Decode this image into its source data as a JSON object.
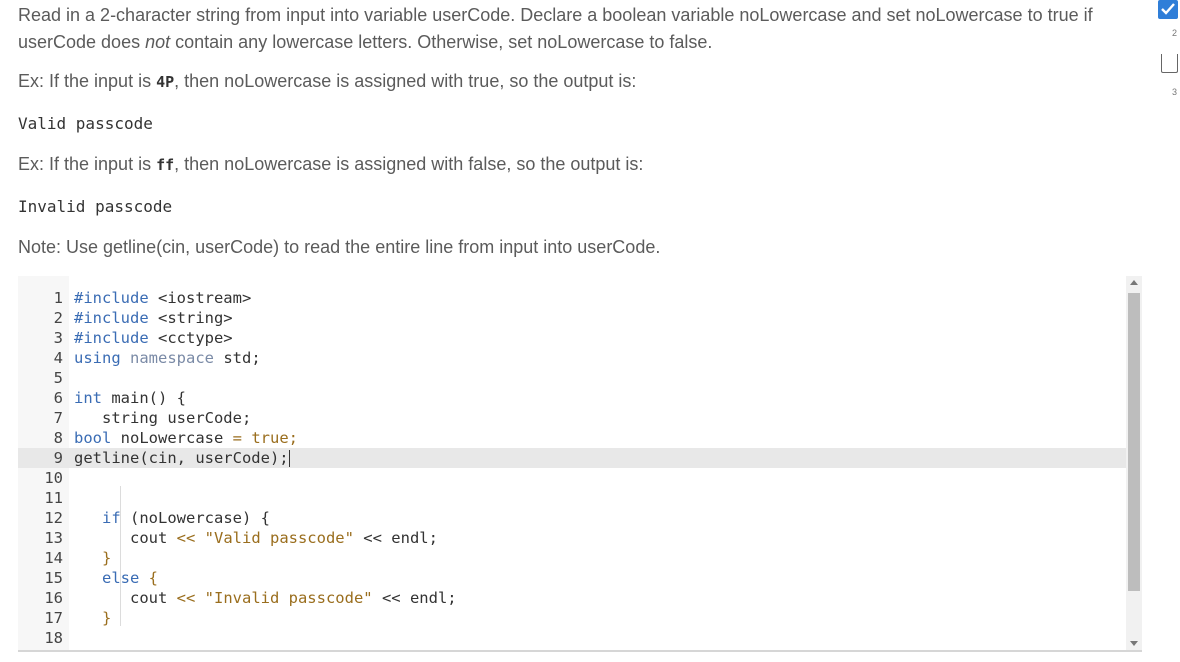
{
  "instructions": {
    "p1_part1": "Read in a 2-character string from input into variable userCode. Declare a boolean variable noLowercase and set noLowercase to true if userCode does ",
    "p1_em": "not",
    "p1_part2": " contain any lowercase letters. Otherwise, set noLowercase to false.",
    "ex1_pre": "Ex: If the input is ",
    "ex1_code": "4P",
    "ex1_post": ", then noLowercase is assigned with true, so the output is:",
    "ex1_output": "Valid passcode",
    "ex2_pre": "Ex: If the input is ",
    "ex2_code": "ff",
    "ex2_post": ", then noLowercase is assigned with false, so the output is:",
    "ex2_output": "Invalid passcode",
    "note": "Note: Use getline(cin, userCode) to read the entire line from input into userCode."
  },
  "editor": {
    "line_numbers": [
      "1",
      "2",
      "3",
      "4",
      "5",
      "6",
      "7",
      "8",
      "9",
      "10",
      "11",
      "12",
      "13",
      "14",
      "15",
      "16",
      "17",
      "18"
    ],
    "code": {
      "l1_kw": "#include",
      "l1_rest": " <iostream>",
      "l2_kw": "#include",
      "l2_rest": " <string>",
      "l3_kw": "#include",
      "l3_rest": " <cctype>",
      "l4_kw": "using",
      "l4_ns": " namespace",
      "l4_rest": " std;",
      "l6_kw": "int",
      "l6_rest": " main() {",
      "l7_rest": "   string userCode;",
      "l8_kw": "bool",
      "l8_rest": " noLowercase ",
      "l8_op": "= true;",
      "l9_rest": "getline(cin, userCode);",
      "l12_kw": "   if",
      "l12_rest": " (noLowercase) {",
      "l13_pre": "      cout ",
      "l13_op": "<<",
      "l13_str": " \"Valid passcode\"",
      "l13_post": " << endl;",
      "l14_rest": "   }",
      "l15_kw": "   else",
      "l15_rest": " {",
      "l16_pre": "      cout ",
      "l16_op": "<<",
      "l16_str": " \"Invalid passcode\"",
      "l16_post": " << endl;",
      "l17_rest": "   }"
    }
  },
  "progress": {
    "item2_label": "2",
    "item3_label": "3",
    "item2_completed": true,
    "item3_completed": false
  },
  "colors": {
    "keyword": "#3a6cb4",
    "string": "#9a6e1e",
    "check": "#2f7ed8"
  }
}
